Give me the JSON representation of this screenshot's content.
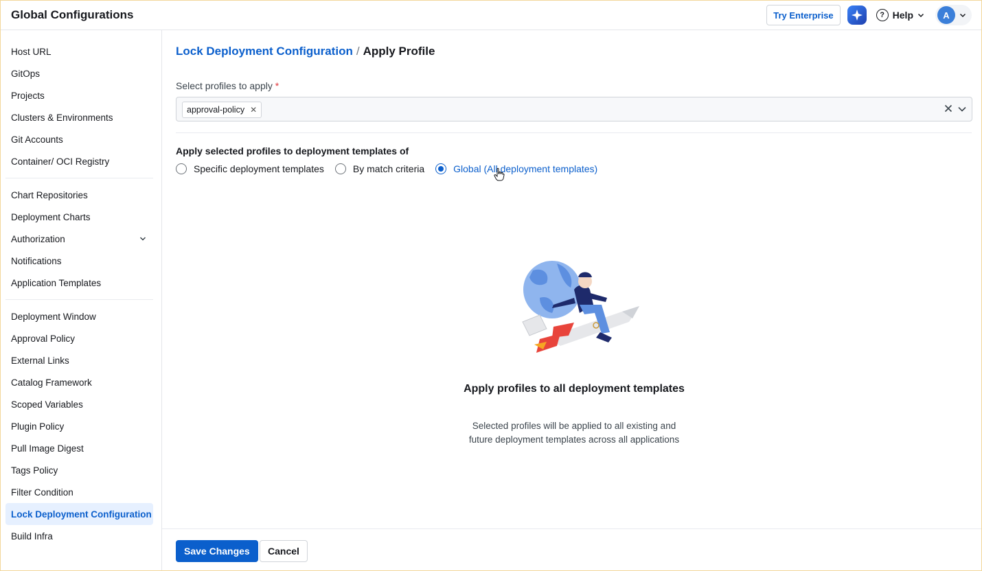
{
  "header": {
    "title": "Global Configurations",
    "try_enterprise": "Try Enterprise",
    "help_label": "Help",
    "avatar_initial": "A"
  },
  "sidebar": {
    "group1": [
      "Host URL",
      "GitOps",
      "Projects",
      "Clusters & Environments",
      "Git Accounts",
      "Container/ OCI Registry"
    ],
    "group2": [
      "Chart Repositories",
      "Deployment Charts",
      "Authorization",
      "Notifications",
      "Application Templates"
    ],
    "group3": [
      "Deployment Window",
      "Approval Policy",
      "External Links",
      "Catalog Framework",
      "Scoped Variables",
      "Plugin Policy",
      "Pull Image Digest",
      "Tags Policy",
      "Filter Condition",
      "Lock Deployment Configuration",
      "Build Infra"
    ],
    "active": "Lock Deployment Configuration"
  },
  "main": {
    "breadcrumb_link": "Lock Deployment Configuration",
    "breadcrumb_sep": "/",
    "breadcrumb_current": "Apply Profile",
    "select_label": "Select profiles to apply",
    "required_mark": "*",
    "selected_chips": [
      "approval-policy"
    ],
    "apply_label": "Apply selected profiles to deployment templates of",
    "radio_options": [
      {
        "label": "Specific deployment templates",
        "checked": false
      },
      {
        "label": "By match criteria",
        "checked": false
      },
      {
        "label": "Global (All deployment templates)",
        "checked": true
      }
    ],
    "empty_title": "Apply profiles to all deployment templates",
    "empty_subtitle": "Selected profiles will be applied to all existing and future deployment templates across all applications"
  },
  "footer": {
    "save_label": "Save Changes",
    "cancel_label": "Cancel"
  },
  "colors": {
    "accent": "#0b5fcc",
    "active_bg": "#e6f0ff"
  }
}
